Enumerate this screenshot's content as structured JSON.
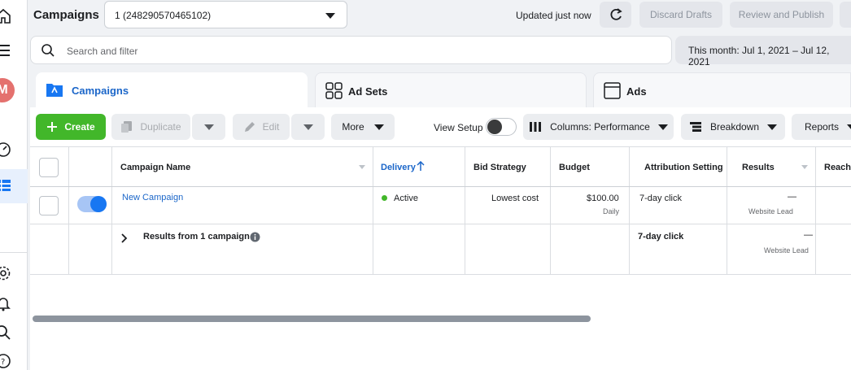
{
  "header": {
    "title": "Campaigns",
    "account": "1 (248290570465102)",
    "updated": "Updated just now",
    "discard_label": "Discard Drafts",
    "publish_label": "Review and Publish"
  },
  "rail": {
    "avatar_letter": "M"
  },
  "search": {
    "placeholder": "Search and filter"
  },
  "date_range": "This month: Jul 1, 2021 – Jul 12, 2021",
  "tabs": [
    {
      "label": "Campaigns"
    },
    {
      "label": "Ad Sets"
    },
    {
      "label": "Ads"
    }
  ],
  "toolbar": {
    "create": "Create",
    "duplicate": "Duplicate",
    "edit": "Edit",
    "more": "More",
    "view_setup": "View Setup",
    "columns": "Columns: Performance",
    "breakdown": "Breakdown",
    "reports": "Reports"
  },
  "columns": {
    "campaign_name": "Campaign Name",
    "delivery": "Delivery",
    "bid_strategy": "Bid Strategy",
    "budget": "Budget",
    "attribution": "Attribution Setting",
    "results": "Results",
    "reach": "Reach"
  },
  "rows": [
    {
      "name": "New Campaign",
      "delivery": "Active",
      "bid_strategy": "Lowest cost",
      "budget": "$100.00",
      "budget_period": "Daily",
      "attribution": "7-day click",
      "results": "—",
      "results_type": "Website Lead"
    }
  ],
  "summary": {
    "label": "Results from 1 campaign",
    "attribution": "7-day click",
    "results": "—",
    "results_type": "Website Lead"
  },
  "colors": {
    "accent": "#1877f2",
    "create": "#42b72a",
    "active": "#42b72a"
  }
}
